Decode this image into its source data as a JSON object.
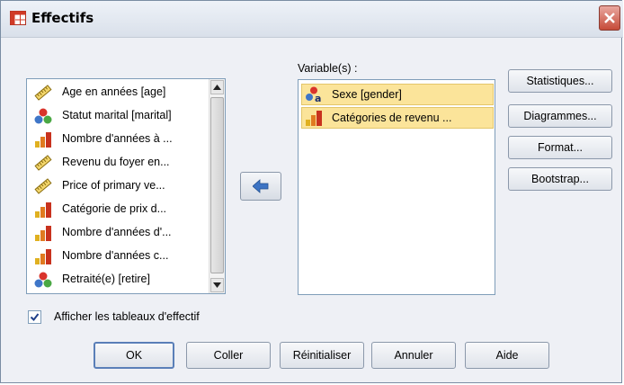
{
  "window": {
    "title": "Effectifs"
  },
  "source_list": {
    "items": [
      {
        "label": "Age en années [age]",
        "icon": "scale-icon"
      },
      {
        "label": "Statut marital [marital]",
        "icon": "nominal-icon"
      },
      {
        "label": "Nombre d'années à ...",
        "icon": "ordinal-icon"
      },
      {
        "label": "Revenu du foyer en...",
        "icon": "scale-icon"
      },
      {
        "label": "Price of primary ve...",
        "icon": "scale-icon"
      },
      {
        "label": "Catégorie de prix d...",
        "icon": "ordinal-icon"
      },
      {
        "label": "Nombre d'années d'...",
        "icon": "ordinal-icon"
      },
      {
        "label": "Nombre d'années c...",
        "icon": "ordinal-icon"
      },
      {
        "label": "Retraité(e) [retire]",
        "icon": "nominal-icon"
      }
    ]
  },
  "target": {
    "label": "Variable(s) :",
    "items": [
      {
        "label": "Sexe [gender]",
        "icon": "nominal-string-icon"
      },
      {
        "label": "Catégories de revenu ...",
        "icon": "ordinal-icon"
      }
    ]
  },
  "side_buttons": {
    "statistiques": "Statistiques...",
    "diagrammes": "Diagrammes...",
    "format": "Format...",
    "bootstrap": "Bootstrap..."
  },
  "checkbox": {
    "label": "Afficher les tableaux d'effectif",
    "checked": true
  },
  "bottom_buttons": {
    "ok": "OK",
    "coller": "Coller",
    "reinitialiser": "Réinitialiser",
    "annuler": "Annuler",
    "aide": "Aide"
  },
  "colors": {
    "selection": "#fbe49a",
    "accent": "#3d74c4",
    "close": "#c64a38"
  }
}
